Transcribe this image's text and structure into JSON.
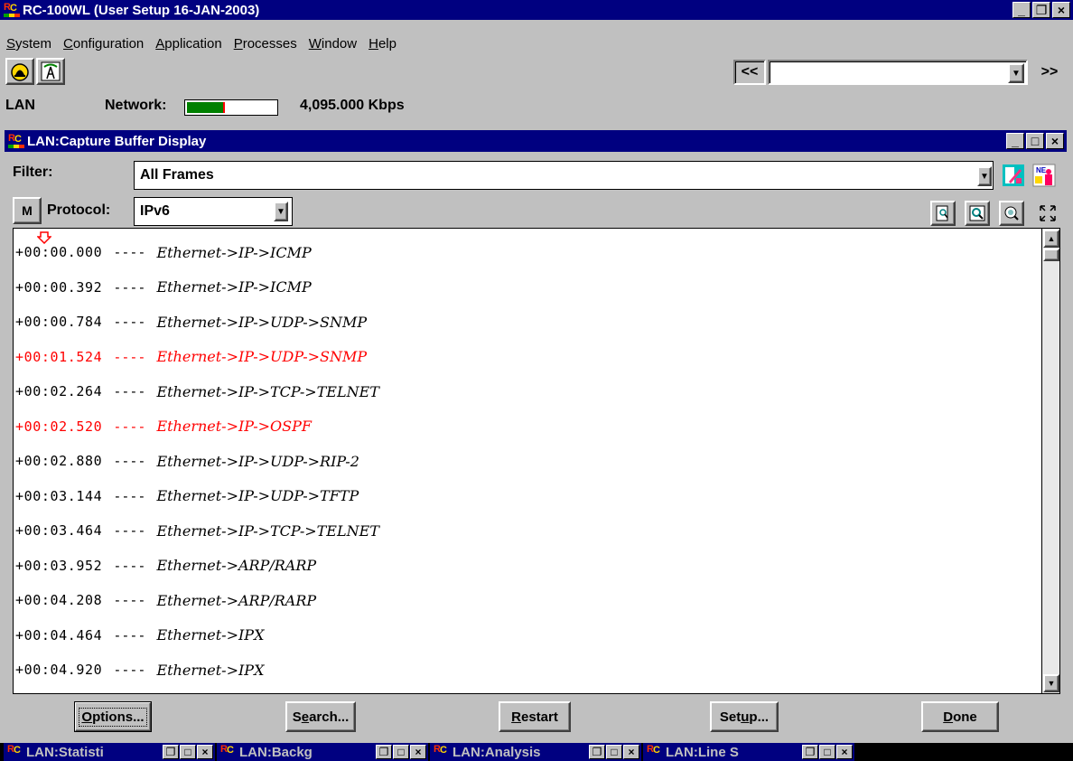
{
  "app": {
    "title": "RC-100WL (User Setup 16-JAN-2003)",
    "buttons": {
      "minimize": "_",
      "restore": "❐",
      "close": "×"
    }
  },
  "menu": [
    {
      "label": "System",
      "accel": "S",
      "rest": "ystem"
    },
    {
      "label": "Configuration",
      "accel": "C",
      "rest": "onfiguration"
    },
    {
      "label": "Application",
      "accel": "A",
      "rest": "pplication"
    },
    {
      "label": "Processes",
      "accel": "P",
      "rest": "rocesses"
    },
    {
      "label": "Window",
      "accel": "W",
      "rest": "indow"
    },
    {
      "label": "Help",
      "accel": "H",
      "rest": "elp"
    }
  ],
  "toolbar": {
    "prev_label": "<<",
    "next_label": ">>",
    "combo_value": "",
    "icons": [
      "bell-icon",
      "antenna-icon"
    ]
  },
  "status": {
    "lan_label": "LAN",
    "network_label": "Network:",
    "network_level": 0.4,
    "rate": "4,095.000 Kbps",
    "colors": {
      "fill": "#008000",
      "peak": "#ff0000"
    }
  },
  "child": {
    "title": "LAN:Capture Buffer Display",
    "filter_label": "Filter:",
    "filter_value": "All Frames",
    "m_label": "M",
    "protocol_label": "Protocol:",
    "protocol_value": "IPv6"
  },
  "frames": [
    {
      "time": "+00:00.000",
      "sep": "----",
      "desc": "Ethernet->IP->ICMP",
      "highlight": false
    },
    {
      "time": "+00:00.392",
      "sep": "----",
      "desc": "Ethernet->IP->ICMP",
      "highlight": false
    },
    {
      "time": "+00:00.784",
      "sep": "----",
      "desc": "Ethernet->IP->UDP->SNMP",
      "highlight": false
    },
    {
      "time": "+00:01.524",
      "sep": "----",
      "desc": "Ethernet->IP->UDP->SNMP",
      "highlight": true
    },
    {
      "time": "+00:02.264",
      "sep": "----",
      "desc": "Ethernet->IP->TCP->TELNET",
      "highlight": false
    },
    {
      "time": "+00:02.520",
      "sep": "----",
      "desc": "Ethernet->IP->OSPF",
      "highlight": true
    },
    {
      "time": "+00:02.880",
      "sep": "----",
      "desc": "Ethernet->IP->UDP->RIP-2",
      "highlight": false
    },
    {
      "time": "+00:03.144",
      "sep": "----",
      "desc": "Ethernet->IP->UDP->TFTP",
      "highlight": false
    },
    {
      "time": "+00:03.464",
      "sep": "----",
      "desc": "Ethernet->IP->TCP->TELNET",
      "highlight": false
    },
    {
      "time": "+00:03.952",
      "sep": "----",
      "desc": "Ethernet->ARP/RARP",
      "highlight": false
    },
    {
      "time": "+00:04.208",
      "sep": "----",
      "desc": "Ethernet->ARP/RARP",
      "highlight": false
    },
    {
      "time": "+00:04.464",
      "sep": "----",
      "desc": "Ethernet->IPX",
      "highlight": false
    },
    {
      "time": "+00:04.920",
      "sep": "----",
      "desc": "Ethernet->IPX",
      "highlight": false
    }
  ],
  "buttons": {
    "options": {
      "accel": "O",
      "rest": "ptions..."
    },
    "search": {
      "pre": "S",
      "accel": "e",
      "rest": "arch..."
    },
    "restart": {
      "accel": "R",
      "rest": "estart"
    },
    "setup": {
      "pre": "Set",
      "accel": "u",
      "rest": "p..."
    },
    "done": {
      "accel": "D",
      "rest": "one"
    }
  },
  "taskbar": [
    {
      "label": "LAN:Statisti"
    },
    {
      "label": "LAN:Backg"
    },
    {
      "label": "LAN:Analysis"
    },
    {
      "label": "LAN:Line S"
    }
  ],
  "colors": {
    "title": "#000080",
    "highlight_row": "#ff0000",
    "face": "#c0c0c0"
  }
}
